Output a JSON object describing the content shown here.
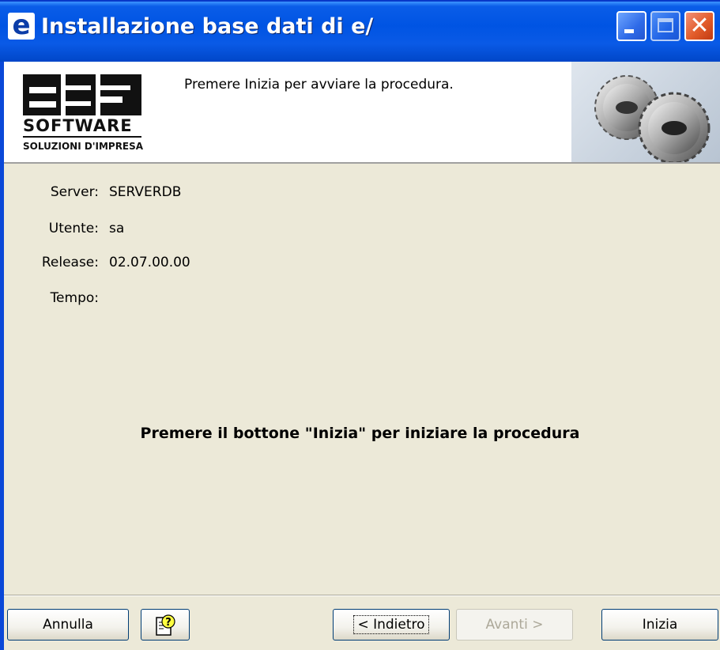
{
  "window": {
    "app_icon_letter": "e",
    "title": "Installazione base dati di e/"
  },
  "header": {
    "logo_text": "esa",
    "logo_software": "SOFTWARE",
    "logo_subtitle": "SOLUZIONI D'IMPRESA",
    "message": "Premere Inizia per avviare la procedura."
  },
  "fields": {
    "server_label": "Server:",
    "server_value": "SERVERDB",
    "user_label": "Utente:",
    "user_value": "sa",
    "release_label": "Release:",
    "release_value": "02.07.00.00",
    "time_label": "Tempo:",
    "time_value": ""
  },
  "main": {
    "instruction": "Premere il bottone \"Inizia\" per iniziare la procedura"
  },
  "buttons": {
    "cancel": "Annulla",
    "help_icon": "help-icon",
    "back": "< Indietro",
    "next": "Avanti >",
    "start": "Inizia"
  },
  "colors": {
    "titlebar": "#0054e3",
    "dialog_bg": "#ece9d8",
    "close_button": "#e25c2a"
  }
}
